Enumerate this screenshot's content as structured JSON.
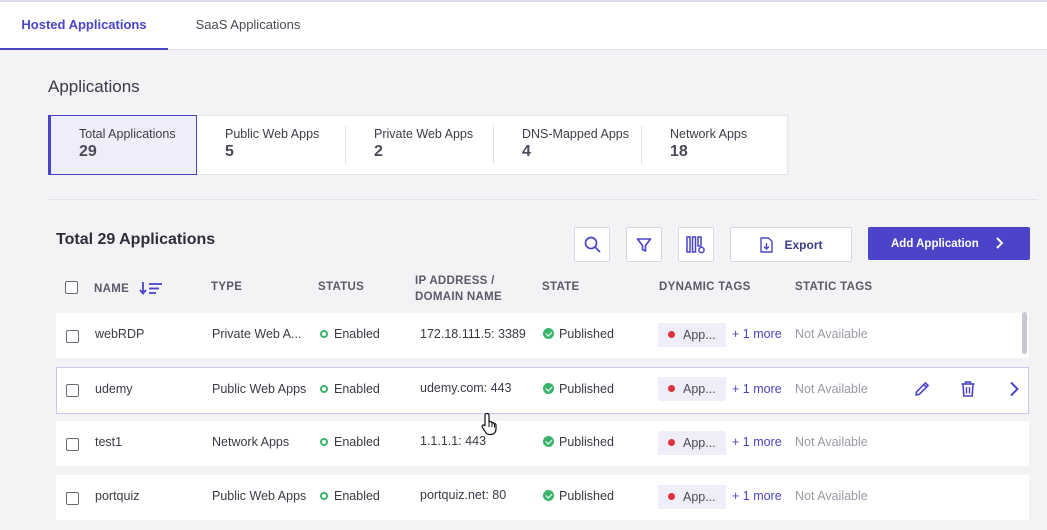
{
  "tabs": [
    {
      "label": "Hosted Applications",
      "active": true
    },
    {
      "label": "SaaS Applications",
      "active": false
    }
  ],
  "page_title": "Applications",
  "summary_cards": [
    {
      "label": "Total Applications",
      "value": "29"
    },
    {
      "label": "Public Web Apps",
      "value": "5"
    },
    {
      "label": "Private Web Apps",
      "value": "2"
    },
    {
      "label": "DNS-Mapped Apps",
      "value": "4"
    },
    {
      "label": "Network Apps",
      "value": "18"
    }
  ],
  "table": {
    "title": "Total 29 Applications",
    "export_label": "Export",
    "add_label": "Add Application",
    "columns": {
      "name": "NAME",
      "type": "TYPE",
      "status": "STATUS",
      "ip_line1": "IP ADDRESS /",
      "ip_line2": "DOMAIN NAME",
      "state": "STATE",
      "dynamic_tags": "DYNAMIC TAGS",
      "static_tags": "STATIC TAGS"
    },
    "rows": [
      {
        "name": "webRDP",
        "type": "Private Web A...",
        "status": "Enabled",
        "address": "172.18.111.5: 3389",
        "state": "Published",
        "tag": "App...",
        "more": "+ 1 more",
        "static": "Not Available"
      },
      {
        "name": "udemy",
        "type": "Public Web Apps",
        "status": "Enabled",
        "address": "udemy.com: 443",
        "state": "Published",
        "tag": "App...",
        "more": "+ 1 more",
        "static": "Not Available"
      },
      {
        "name": "test1",
        "type": "Network Apps",
        "status": "Enabled",
        "address": "1.1.1.1: 443",
        "state": "Published",
        "tag": "App...",
        "more": "+ 1 more",
        "static": "Not Available"
      },
      {
        "name": "portquiz",
        "type": "Public Web Apps",
        "status": "Enabled",
        "address": "portquiz.net: 80",
        "state": "Published",
        "tag": "App...",
        "more": "+ 1 more",
        "static": "Not Available"
      }
    ]
  },
  "colors": {
    "accent": "#4b44c9",
    "status_green": "#3bb46b",
    "tag_red": "#e0313c"
  },
  "icons": [
    "search-icon",
    "filter-icon",
    "column-settings-icon",
    "export-icon",
    "chevron-right-icon",
    "sort-icon",
    "edit-icon",
    "delete-icon",
    "pointer-cursor-icon"
  ]
}
